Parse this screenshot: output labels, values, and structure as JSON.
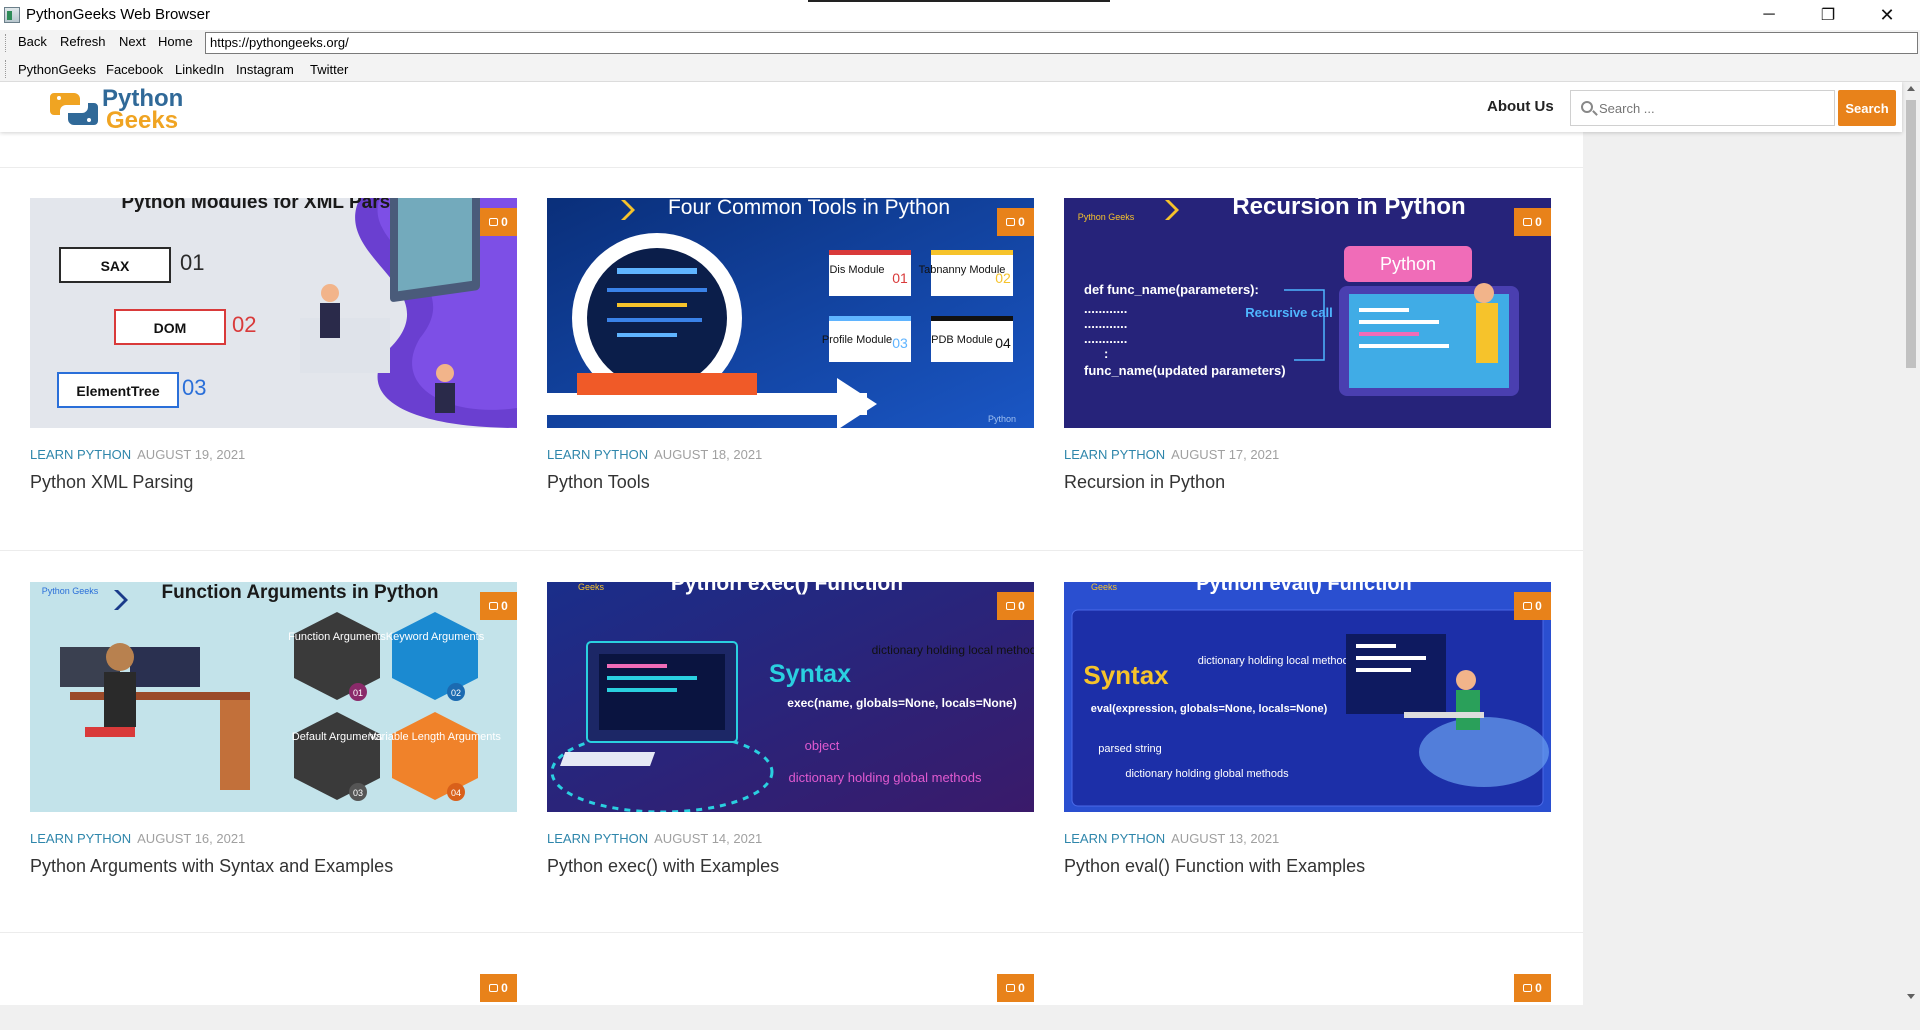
{
  "window": {
    "title": "PythonGeeks Web Browser",
    "controls": {
      "minimize": "─",
      "maximize": "❐",
      "close": "✕"
    }
  },
  "navbar": {
    "back": "Back",
    "refresh": "Refresh",
    "next": "Next",
    "home": "Home",
    "url": "https://pythongeeks.org/"
  },
  "bookmarks": [
    "PythonGeeks",
    "Facebook",
    "LinkedIn",
    "Instagram",
    "Twitter"
  ],
  "site": {
    "logo": {
      "word1": "Python",
      "word2": "Geeks"
    },
    "about_label": "About Us",
    "search_placeholder": "Search ...",
    "search_button": "Search"
  },
  "posts": [
    {
      "category": "LEARN PYTHON",
      "date": "AUGUST 19, 2021",
      "title": "Python XML Parsing",
      "comments": "0",
      "image": {
        "heading": "Python Modules for XML Parsing",
        "items": [
          "SAX",
          "DOM",
          "ElementTree"
        ],
        "numbers": [
          "01",
          "02",
          "03"
        ]
      }
    },
    {
      "category": "LEARN PYTHON",
      "date": "AUGUST 18, 2021",
      "title": "Python Tools",
      "comments": "0",
      "image": {
        "heading": "Four Common Tools in Python",
        "items": [
          "Dis Module",
          "Tabnanny Module",
          "Profile Module",
          "PDB Module"
        ],
        "numbers": [
          "01",
          "02",
          "03",
          "04"
        ],
        "brand": "Python"
      }
    },
    {
      "category": "LEARN PYTHON",
      "date": "AUGUST 17, 2021",
      "title": "Recursion in Python",
      "comments": "0",
      "image": {
        "heading": "Recursion in Python",
        "brand": "Python Geeks",
        "tag": "Python",
        "code1": "def func_name(parameters):",
        "dots": "............",
        "colon": ":",
        "code2": "func_name(updated parameters)",
        "label": "Recursive call"
      }
    },
    {
      "category": "LEARN PYTHON",
      "date": "AUGUST 16, 2021",
      "title": "Python Arguments with Syntax and Examples",
      "comments": "0",
      "image": {
        "heading": "Function Arguments in Python",
        "brand": "Python Geeks",
        "items": [
          "Function Arguments",
          "Keyword Arguments",
          "Default Arguments",
          "Variable Length Arguments"
        ],
        "numbers": [
          "01",
          "02",
          "03",
          "04"
        ]
      }
    },
    {
      "category": "LEARN PYTHON",
      "date": "AUGUST 14, 2021",
      "title": "Python exec() with Examples",
      "comments": "0",
      "image": {
        "heading": "Python exec() Function",
        "brand": "Geeks",
        "syntax": "Syntax",
        "code": "exec(name, globals=None, locals=None)",
        "note1": "dictionary holding local methods",
        "note2": "object",
        "note3": "dictionary holding global methods"
      }
    },
    {
      "category": "LEARN PYTHON",
      "date": "AUGUST 13, 2021",
      "title": "Python eval() Function with Examples",
      "comments": "0",
      "image": {
        "heading": "Python eval() Function",
        "brand": "Geeks",
        "syntax": "Syntax",
        "code": "eval(expression, globals=None, locals=None)",
        "note1": "dictionary holding local methods",
        "note2": "parsed string",
        "note3": "dictionary holding global methods"
      }
    }
  ],
  "partial_badges": [
    "0",
    "0",
    "0"
  ],
  "colors": {
    "accent": "#e8821a",
    "category": "#2e86ab",
    "logo_blue": "#306998",
    "logo_yellow": "#f0a422"
  }
}
